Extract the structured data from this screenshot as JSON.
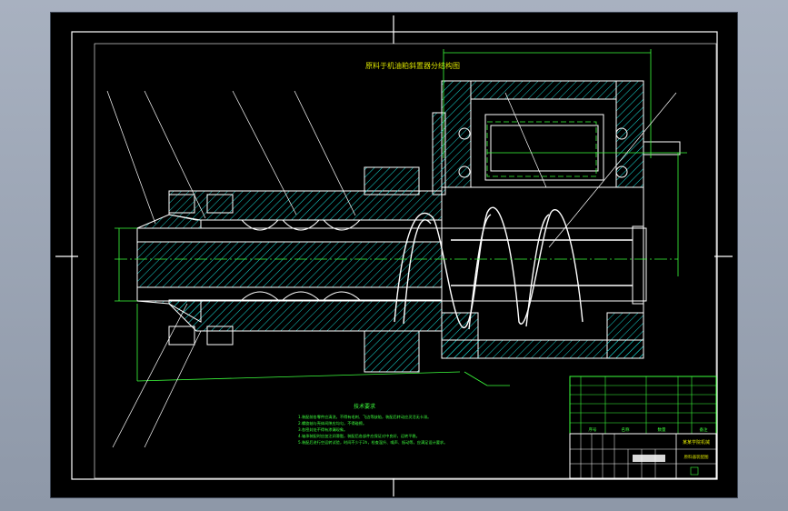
{
  "drawing": {
    "title": "原料于机油粕斜置器分结构图",
    "notes_heading": "技术要求",
    "notes": [
      "1.装配前各零件应清洗，不得有毛刺、飞边等缺陷，装配后转动应灵活无卡滞。",
      "2.螺旋轴与壳体间隙应均匀，不得碰擦。",
      "3.各密封处不得有渗漏现象。",
      "4.轴承装配时应加注润滑脂，装配后各部件应保证对中良好，运转平稳。",
      "5.装配后进行空运转试验，时间不少于2h，检查温升、噪声、振动等，应满足设计要求。"
    ],
    "titleblock": {
      "school": "某某学院机械",
      "drawing_name": "原料器装配图",
      "col_headers": [
        "序号",
        "名称",
        "数量",
        "备注"
      ]
    },
    "colors": {
      "frame": "#ffffff",
      "outline": "#ffffff",
      "hatch": "#18d7d2",
      "center": "#3dff3d",
      "dimension": "#3dff3d",
      "text": "#3dff3d",
      "title_text": "#d8e000"
    }
  }
}
